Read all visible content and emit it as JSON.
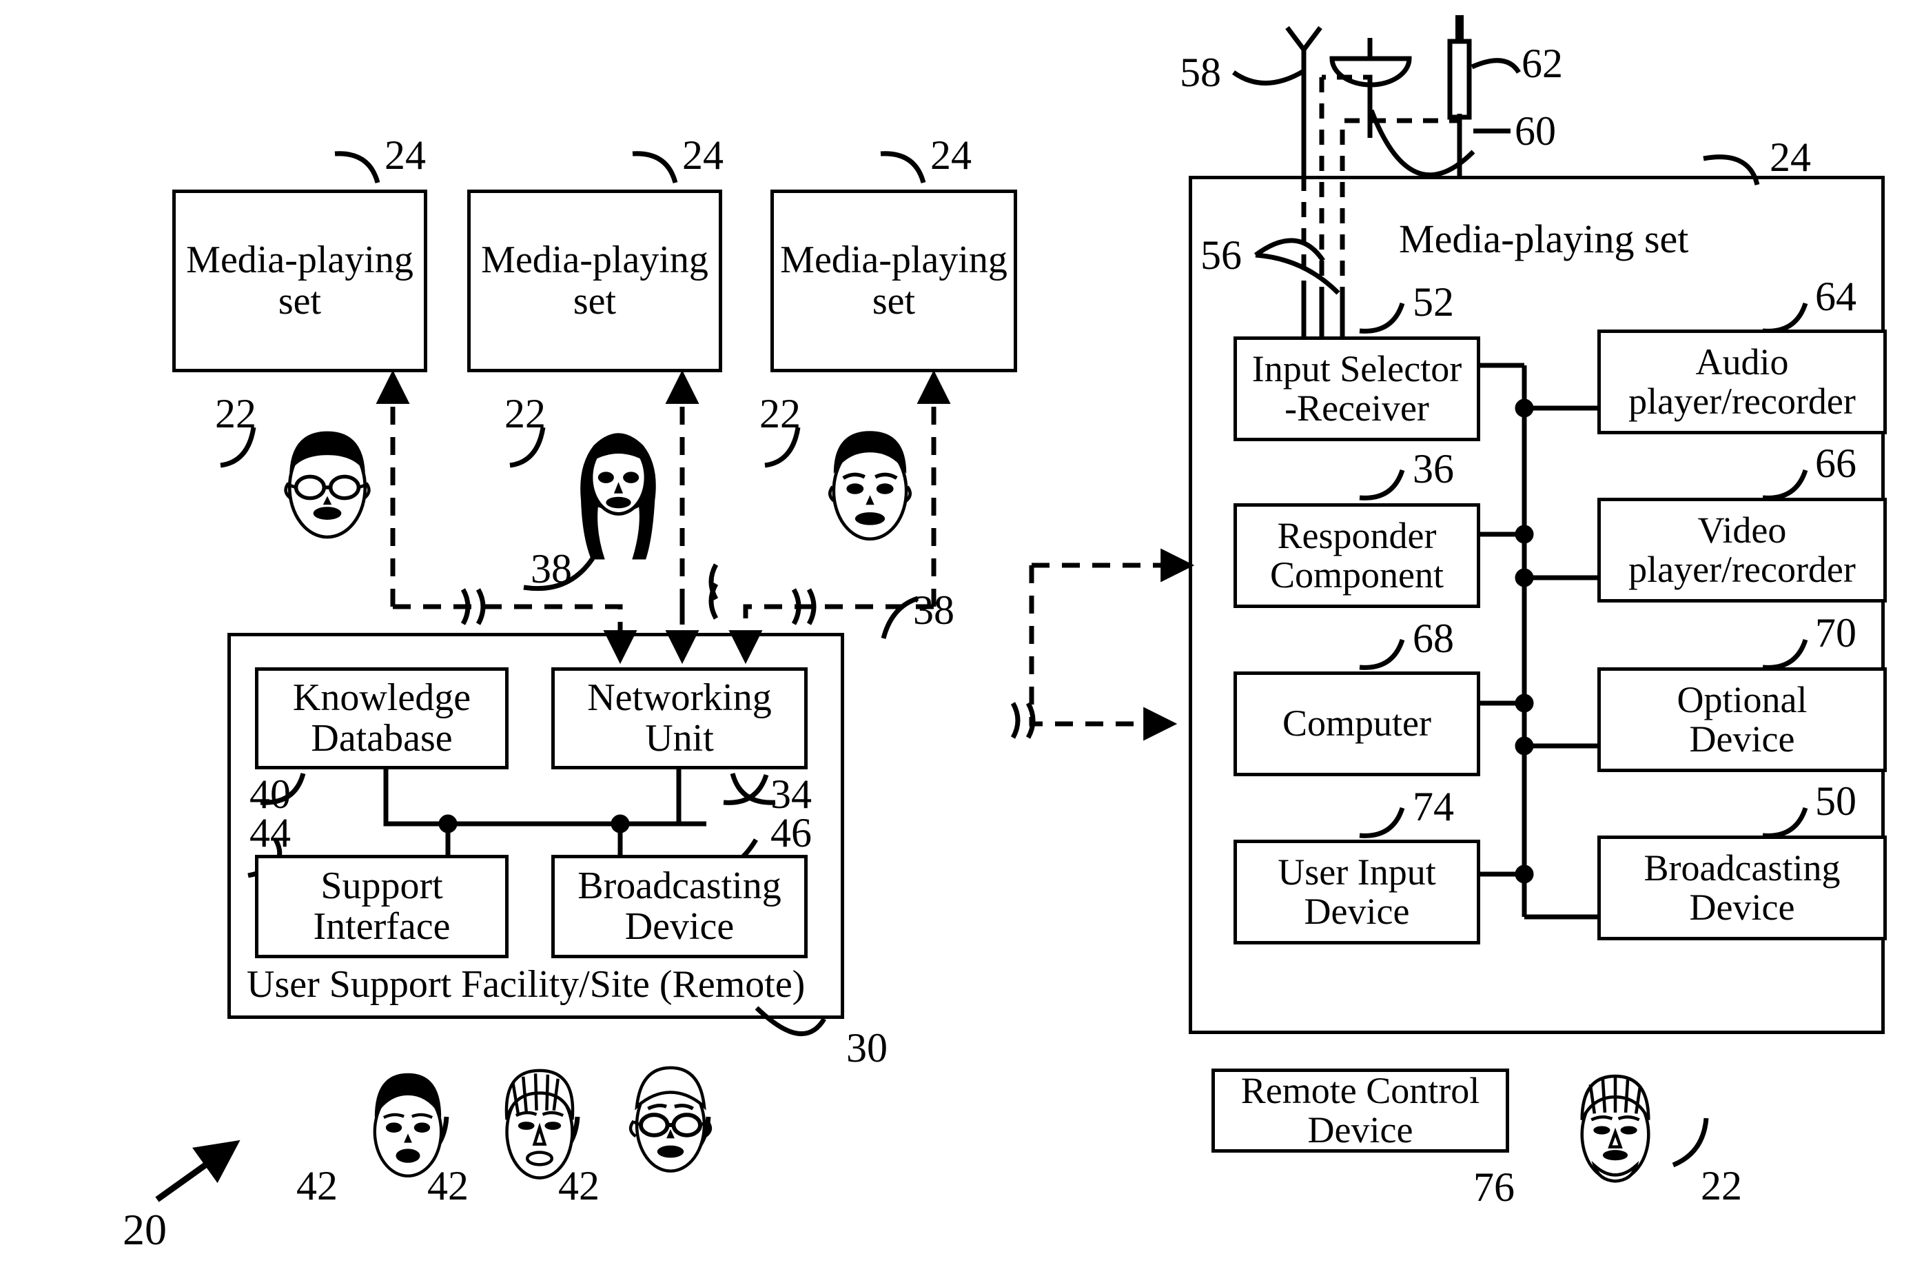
{
  "figure": {
    "title": "Media-playing set and user support facility block diagram",
    "system_ref": "20"
  },
  "left_panel": {
    "media_sets": [
      {
        "label": "Media-playing\nset",
        "ref": "24",
        "user_ref": "22"
      },
      {
        "label": "Media-playing\nset",
        "ref": "24",
        "user_ref": "22"
      },
      {
        "label": "Media-playing\nset",
        "ref": "24",
        "user_ref": "22"
      }
    ],
    "link_refs": [
      "38",
      "38",
      "38"
    ],
    "facility": {
      "caption": "User Support Facility/Site (Remote)",
      "ref": "30",
      "blocks": [
        {
          "label": "Knowledge\nDatabase",
          "ref": "40"
        },
        {
          "label": "Networking\nUnit",
          "ref": "34"
        },
        {
          "label": "Support\nInterface",
          "ref": "44"
        },
        {
          "label": "Broadcasting\nDevice",
          "ref": "46"
        }
      ]
    },
    "support_people": [
      {
        "ref": "42"
      },
      {
        "ref": "42"
      },
      {
        "ref": "42"
      }
    ]
  },
  "right_panel": {
    "title": "Media-playing set",
    "ref": "24",
    "antennas": [
      {
        "ref": "58",
        "type": "dipole-antenna"
      },
      {
        "ref": "60",
        "type": "satellite-dish-antenna"
      },
      {
        "ref": "62",
        "type": "cable-connector"
      }
    ],
    "input_lines_ref": "56",
    "blocks": [
      {
        "label": "Input Selector\n-Receiver",
        "ref": "52"
      },
      {
        "label": "Audio\nplayer/recorder",
        "ref": "64"
      },
      {
        "label": "Responder\nComponent",
        "ref": "36"
      },
      {
        "label": "Video\nplayer/recorder",
        "ref": "66"
      },
      {
        "label": "Computer",
        "ref": "68"
      },
      {
        "label": "Optional\nDevice",
        "ref": "70"
      },
      {
        "label": "User Input\nDevice",
        "ref": "74"
      },
      {
        "label": "Broadcasting\nDevice",
        "ref": "50"
      }
    ],
    "remote_control": {
      "label": "Remote Control\nDevice",
      "ref": "76"
    },
    "viewer_ref": "22"
  }
}
